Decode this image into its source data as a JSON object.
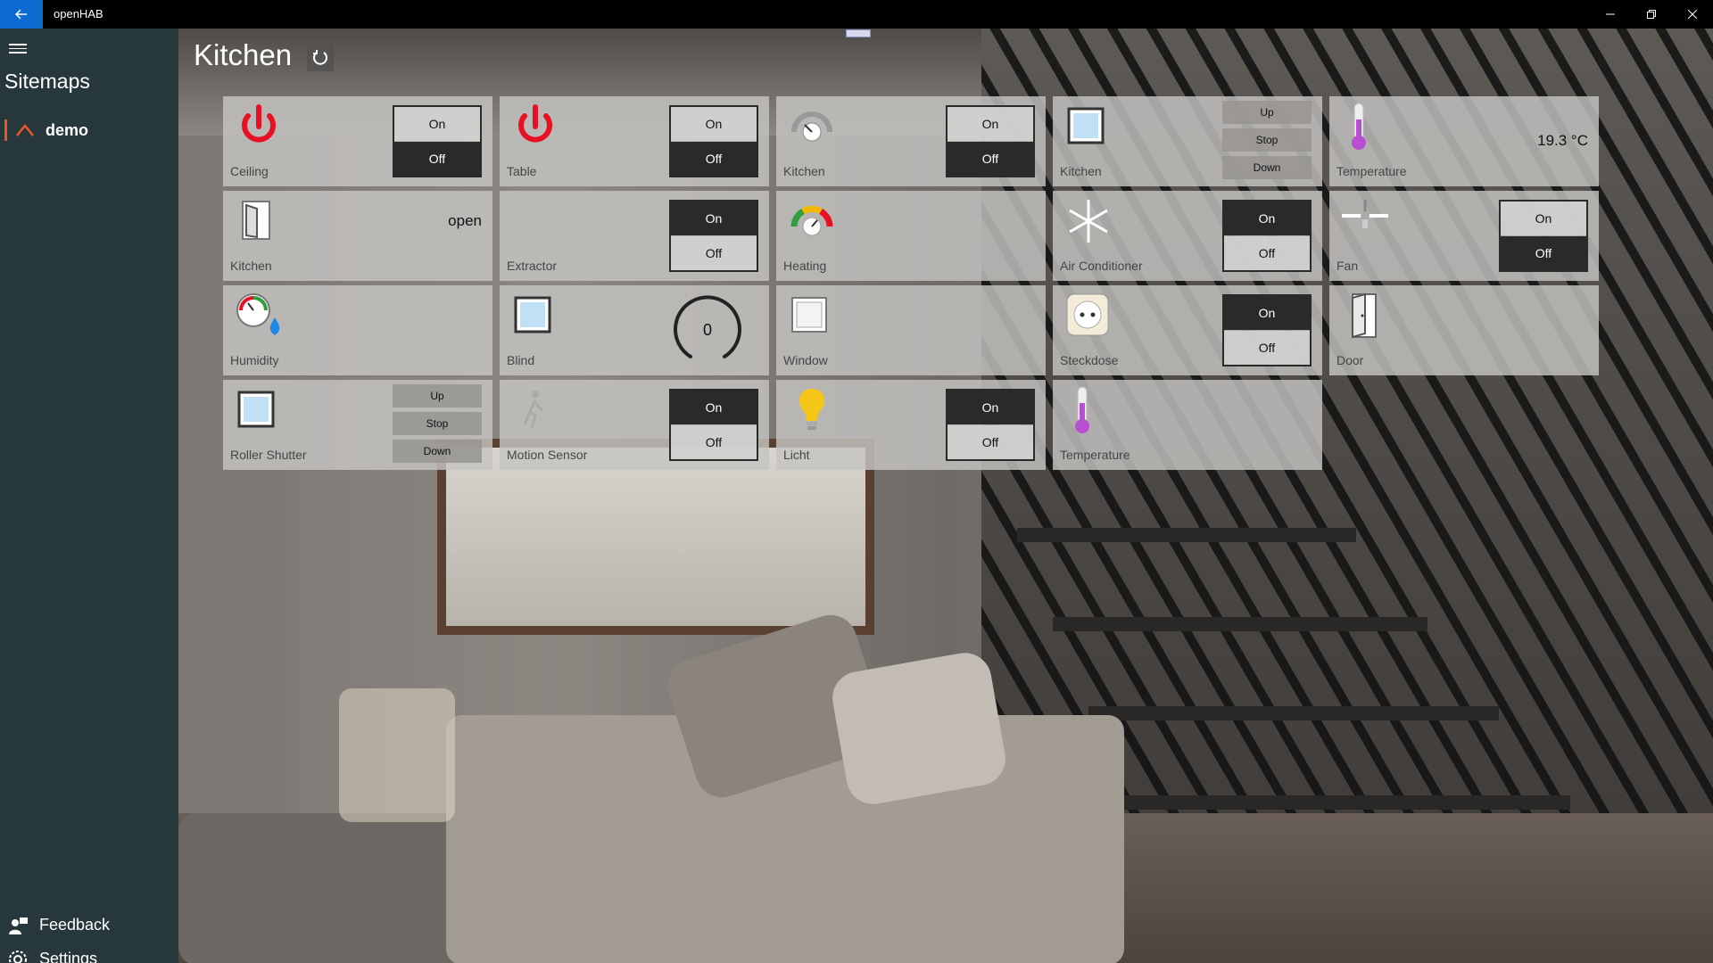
{
  "window": {
    "app_title": "openHAB"
  },
  "sidebar": {
    "title": "Sitemaps",
    "items": [
      {
        "label": "demo"
      }
    ],
    "footer": [
      {
        "label": "Feedback",
        "icon": "feedback-icon"
      },
      {
        "label": "Settings",
        "icon": "gear-icon"
      }
    ]
  },
  "page": {
    "title": "Kitchen"
  },
  "switch": {
    "on": "On",
    "off": "Off"
  },
  "rollershutter": {
    "up": "Up",
    "stop": "Stop",
    "down": "Down"
  },
  "widgets": [
    {
      "label": "Ceiling",
      "icon": "power-icon",
      "type": "switch",
      "state": "Off"
    },
    {
      "label": "Table",
      "icon": "power-icon",
      "type": "switch",
      "state": "Off"
    },
    {
      "label": "Kitchen",
      "icon": "dimmer-icon",
      "type": "switch",
      "state": "Off"
    },
    {
      "label": "Kitchen",
      "icon": "blind-icon",
      "type": "rollershutter"
    },
    {
      "label": "Temperature",
      "icon": "thermometer-icon",
      "type": "text",
      "value": "19.3 °C"
    },
    {
      "label": "Kitchen",
      "icon": "door-open-icon",
      "type": "text",
      "value": "open"
    },
    {
      "label": "Extractor",
      "icon": "none",
      "type": "switch",
      "state": "On"
    },
    {
      "label": "Heating",
      "icon": "gauge-icon",
      "type": "text",
      "value": ""
    },
    {
      "label": "Air Conditioner",
      "icon": "snowflake-icon",
      "type": "switch",
      "state": "On"
    },
    {
      "label": "Fan",
      "icon": "fan-icon",
      "type": "switch",
      "state": "Off"
    },
    {
      "label": "Humidity",
      "icon": "humidity-icon",
      "type": "text",
      "value": ""
    },
    {
      "label": "Blind",
      "icon": "blind-icon",
      "type": "dial",
      "value": "0"
    },
    {
      "label": "Window",
      "icon": "window-icon",
      "type": "text",
      "value": ""
    },
    {
      "label": "Steckdose",
      "icon": "socket-icon",
      "type": "switch",
      "state": "On"
    },
    {
      "label": "Door",
      "icon": "door-icon",
      "type": "text",
      "value": ""
    },
    {
      "label": "Roller Shutter",
      "icon": "blind-icon",
      "type": "rollershutter"
    },
    {
      "label": "Motion Sensor",
      "icon": "motion-icon",
      "type": "switch",
      "state": "On"
    },
    {
      "label": "Licht",
      "icon": "bulb-icon",
      "type": "switch",
      "state": "On"
    },
    {
      "label": "Temperature",
      "icon": "thermometer-icon",
      "type": "text",
      "value": ""
    }
  ],
  "colors": {
    "sidebar_bg": "#27383d",
    "accent": "#e8572a",
    "switch_active": "#2a2a2a",
    "power_red": "#e81123"
  }
}
